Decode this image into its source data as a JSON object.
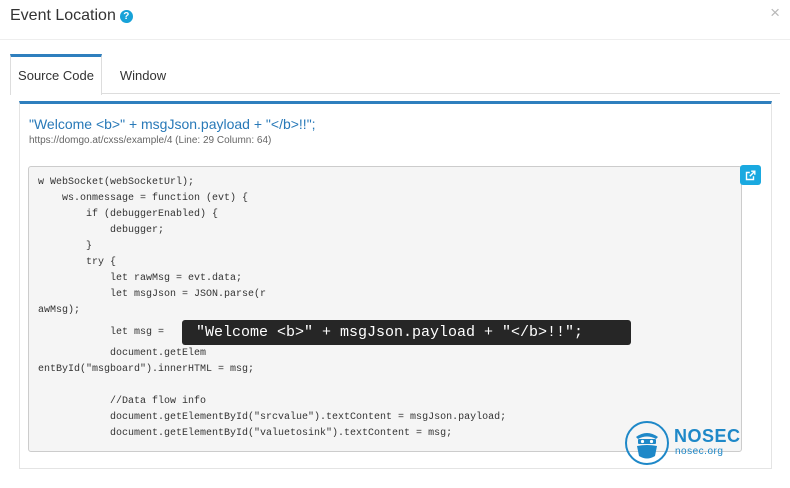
{
  "modal": {
    "title": "Event Location",
    "help_icon_glyph": "?",
    "close_glyph": "×"
  },
  "tabs": [
    {
      "label": "Source Code",
      "active": true
    },
    {
      "label": "Window",
      "active": false
    }
  ],
  "panel": {
    "title": "\"Welcome <b>\" + msgJson.payload + \"</b>!!\";",
    "location": "https://domgo.at/cxss/example/4 (Line: 29 Column: 64)"
  },
  "code_lines": [
    "w WebSocket(webSocketUrl);",
    "    ws.onmessage = function (evt) {",
    "        if (debuggerEnabled) {",
    "            debugger;",
    "        }",
    "        try {",
    "            let rawMsg = evt.data;",
    "            let msgJson = JSON.parse(r",
    "awMsg);",
    "            let msg =",
    "            document.getElem",
    "entById(\"msgboard\").innerHTML = msg;",
    "",
    "            //Data flow info",
    "            document.getElementById(\"srcvalue\").textContent = msgJson.payload;",
    "            document.getElementById(\"valuetosink\").textContent = msg;"
  ],
  "tooltip": {
    "text": "\"Welcome <b>\" + msgJson.payload + \"</b>!!\";"
  },
  "external_button": {
    "icon": "external-link-icon"
  },
  "logo": {
    "name": "NOSEC",
    "url": "nosec.org"
  },
  "colors": {
    "accent": "#2f7fbe",
    "title_link": "#2879b8",
    "help_icon": "#17a2d8",
    "external_button": "#1aa9e0",
    "tooltip_bg": "#262626",
    "logo": "#1e88c8"
  }
}
